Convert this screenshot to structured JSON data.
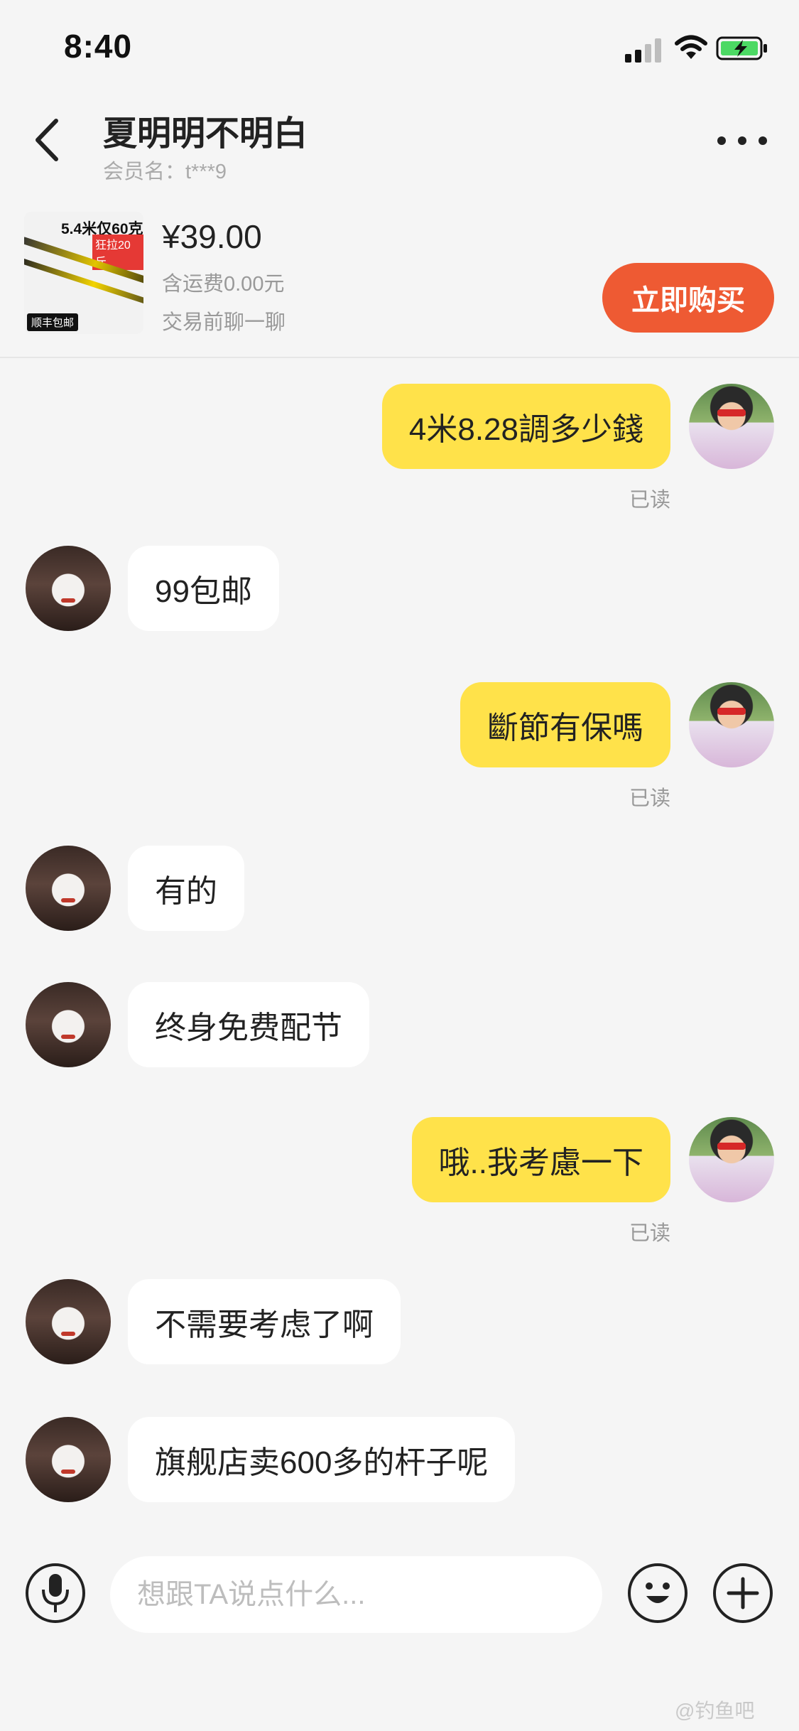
{
  "status_bar": {
    "time": "8:40"
  },
  "header": {
    "title": "夏明明不明白",
    "subtitle": "会员名：t***9"
  },
  "product": {
    "thumb_headline": "5.4米仅60克",
    "thumb_badge": "狂拉20斤",
    "thumb_footer": "顺丰包邮",
    "price": "¥39.00",
    "shipping": "含运费0.00元",
    "note": "交易前聊一聊",
    "buy_label": "立即购买"
  },
  "messages": [
    {
      "from": "me",
      "text": "4米8.28調多少錢",
      "status": "已读"
    },
    {
      "from": "them",
      "text": "99包邮"
    },
    {
      "from": "me",
      "text": "斷節有保嗎",
      "status": "已读"
    },
    {
      "from": "them",
      "text": "有的"
    },
    {
      "from": "them",
      "text": "终身免费配节"
    },
    {
      "from": "me",
      "text": "哦..我考慮一下",
      "status": "已读"
    },
    {
      "from": "them",
      "text": "不需要考虑了啊"
    },
    {
      "from": "them",
      "text": "旗舰店卖600多的杆子呢"
    }
  ],
  "input": {
    "placeholder": "想跟TA说点什么..."
  },
  "watermark": "@钓鱼吧",
  "colors": {
    "my_bubble": "#ffe24a",
    "their_bubble": "#ffffff",
    "buy_button": "#ee5a33",
    "background": "#f5f5f5"
  },
  "icons": [
    "back-arrow-icon",
    "more-dots-icon",
    "microphone-icon",
    "emoji-icon",
    "plus-icon",
    "wifi-icon",
    "battery-charging-icon",
    "signal-icon"
  ]
}
